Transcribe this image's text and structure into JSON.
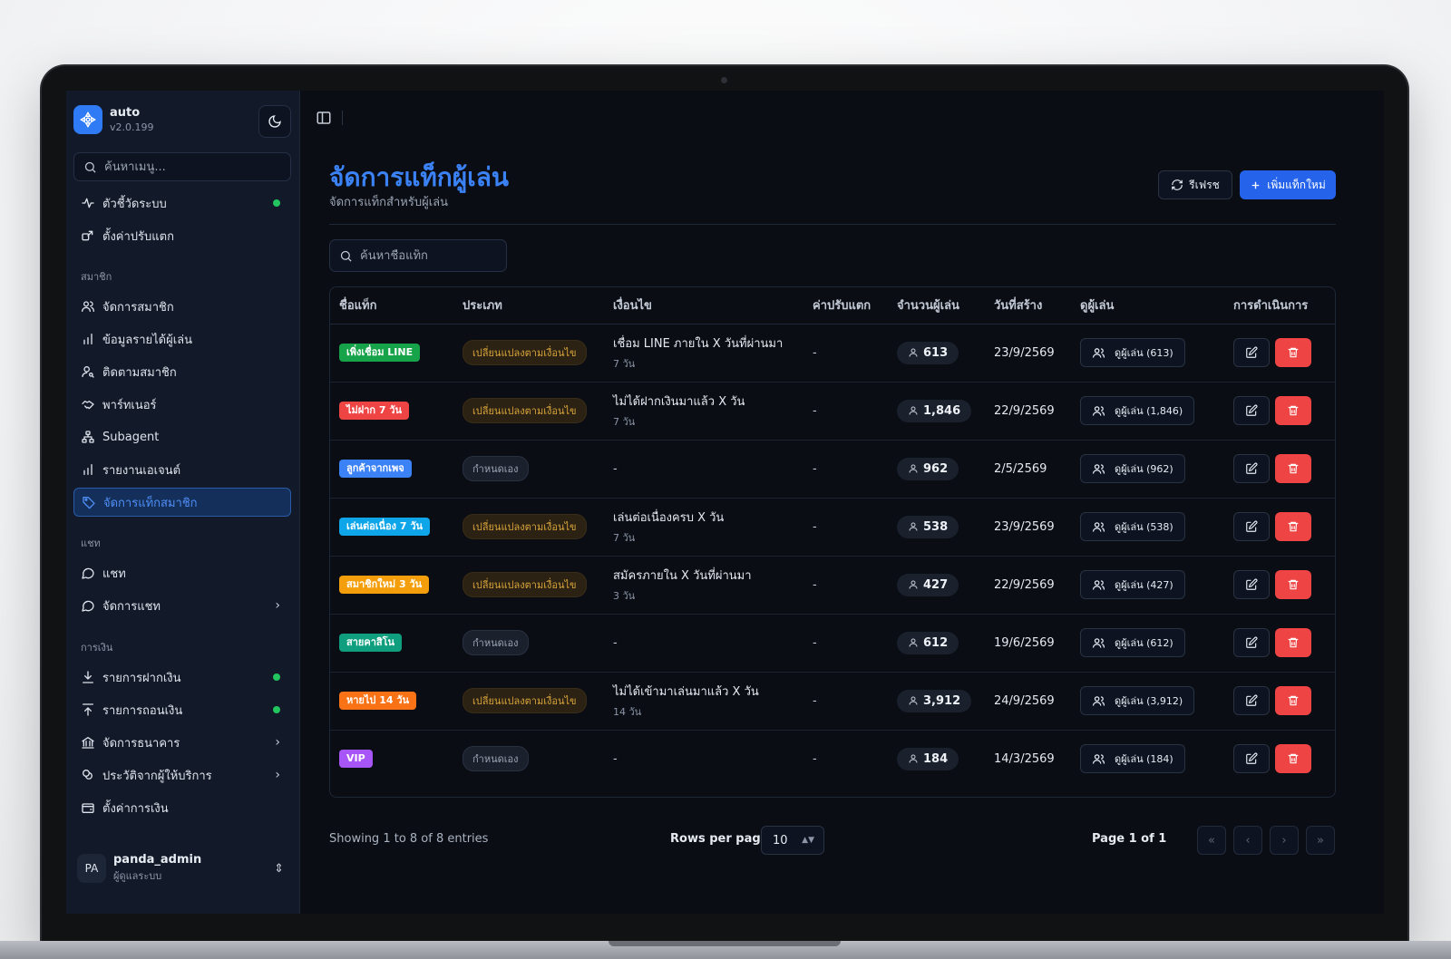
{
  "app": {
    "name": "auto",
    "version": "v2.0.199"
  },
  "sidebar": {
    "search_placeholder": "ค้นหาเมนู...",
    "top_items": [
      {
        "label": "ตัวชี้วัดระบบ",
        "icon": "activity-icon",
        "status_dot": true
      },
      {
        "label": "ตั้งค่าปรับแตก",
        "icon": "settings-share-icon"
      }
    ],
    "sections": [
      {
        "label": "สมาชิก",
        "items": [
          {
            "label": "จัดการสมาชิก",
            "icon": "users-icon"
          },
          {
            "label": "ข้อมูลรายได้ผู้เล่น",
            "icon": "bar-chart-icon"
          },
          {
            "label": "ติดตามสมาชิก",
            "icon": "user-search-icon"
          },
          {
            "label": "พาร์ทเนอร์",
            "icon": "handshake-icon"
          },
          {
            "label": "Subagent",
            "icon": "network-icon"
          },
          {
            "label": "รายงานเอเจนต์",
            "icon": "bar-chart-icon"
          },
          {
            "label": "จัดการแท็กสมาชิก",
            "icon": "tag-icon",
            "active": true
          }
        ]
      },
      {
        "label": "แชท",
        "items": [
          {
            "label": "แชท",
            "icon": "chat-icon"
          },
          {
            "label": "จัดการแชท",
            "icon": "chat-icon",
            "chevron": true
          }
        ]
      },
      {
        "label": "การเงิน",
        "items": [
          {
            "label": "รายการฝากเงิน",
            "icon": "download-icon",
            "status_dot": true
          },
          {
            "label": "รายการถอนเงิน",
            "icon": "upload-icon",
            "status_dot": true
          },
          {
            "label": "จัดการธนาคาร",
            "icon": "bank-icon",
            "chevron": true
          },
          {
            "label": "ประวัติจากผู้ให้บริการ",
            "icon": "coins-icon",
            "chevron": true
          },
          {
            "label": "ตั้งค่าการเงิน",
            "icon": "wallet-icon"
          }
        ]
      }
    ],
    "user": {
      "initials": "PA",
      "name": "panda_admin",
      "role": "ผู้ดูแลระบบ"
    }
  },
  "header": {
    "title": "จัดการแท็กผู้เล่น",
    "subtitle": "จัดการแท็กสำหรับผู้เล่น",
    "refresh_label": "รีเฟรช",
    "add_label": "เพิ่มแท็กใหม่"
  },
  "search": {
    "placeholder": "ค้นหาชื่อแท็ก"
  },
  "table": {
    "columns": [
      "ชื่อแท็ก",
      "ประเภท",
      "เงื่อนไข",
      "ค่าปรับแตก",
      "จำนวนผู้เล่น",
      "วันที่สร้าง",
      "ดูผู้เล่น",
      "การดำเนินการ"
    ],
    "rows": [
      {
        "tag": "เพิ่งเชื่อม LINE",
        "tag_color": "#16a34a",
        "type": "เปลี่ยนแปลงตามเงื่อนไข",
        "type_kind": "change",
        "condition": "เชื่อม LINE ภายใน X วันที่ผ่านมา",
        "condition_sub": "7 วัน",
        "adjust": "-",
        "players": "613",
        "created": "23/9/2569",
        "view": "ดูผู้เล่น (613)"
      },
      {
        "tag": "ไม่ฝาก 7 วัน",
        "tag_color": "#ef4444",
        "type": "เปลี่ยนแปลงตามเงื่อนไข",
        "type_kind": "change",
        "condition": "ไม่ได้ฝากเงินมาแล้ว X วัน",
        "condition_sub": "7 วัน",
        "adjust": "-",
        "players": "1,846",
        "created": "22/9/2569",
        "view": "ดูผู้เล่น (1,846)"
      },
      {
        "tag": "ลูกค้าจากเพจ",
        "tag_color": "#3b82f6",
        "type": "กำหนดเอง",
        "type_kind": "custom",
        "condition": "-",
        "condition_sub": "",
        "adjust": "-",
        "players": "962",
        "created": "2/5/2569",
        "view": "ดูผู้เล่น (962)"
      },
      {
        "tag": "เล่นต่อเนื่อง 7 วัน",
        "tag_color": "#0ea5e9",
        "type": "เปลี่ยนแปลงตามเงื่อนไข",
        "type_kind": "change",
        "condition": "เล่นต่อเนื่องครบ X วัน",
        "condition_sub": "7 วัน",
        "adjust": "-",
        "players": "538",
        "created": "23/9/2569",
        "view": "ดูผู้เล่น (538)"
      },
      {
        "tag": "สมาชิกใหม่ 3 วัน",
        "tag_color": "#f59e0b",
        "type": "เปลี่ยนแปลงตามเงื่อนไข",
        "type_kind": "change",
        "condition": "สมัครภายใน X วันที่ผ่านมา",
        "condition_sub": "3 วัน",
        "adjust": "-",
        "players": "427",
        "created": "22/9/2569",
        "view": "ดูผู้เล่น (427)"
      },
      {
        "tag": "สายคาสิโน",
        "tag_color": "#0f9f7e",
        "type": "กำหนดเอง",
        "type_kind": "custom",
        "condition": "-",
        "condition_sub": "",
        "adjust": "-",
        "players": "612",
        "created": "19/6/2569",
        "view": "ดูผู้เล่น (612)"
      },
      {
        "tag": "หายไป 14 วัน",
        "tag_color": "#f97316",
        "type": "เปลี่ยนแปลงตามเงื่อนไข",
        "type_kind": "change",
        "condition": "ไม่ได้เข้ามาเล่นมาแล้ว X วัน",
        "condition_sub": "14 วัน",
        "adjust": "-",
        "players": "3,912",
        "created": "24/9/2569",
        "view": "ดูผู้เล่น (3,912)"
      },
      {
        "tag": "VIP",
        "tag_color": "#a855f7",
        "type": "กำหนดเอง",
        "type_kind": "custom",
        "condition": "-",
        "condition_sub": "",
        "adjust": "-",
        "players": "184",
        "created": "14/3/2569",
        "view": "ดูผู้เล่น (184)"
      }
    ]
  },
  "footer": {
    "showing": "Showing 1 to 8 of 8 entries",
    "rows_per_page_label": "Rows per page",
    "rows_per_page_value": "10",
    "page_label": "Page 1 of 1"
  },
  "colors": {
    "accent": "#2563eb",
    "danger": "#ef4444",
    "online": "#22c55e"
  }
}
